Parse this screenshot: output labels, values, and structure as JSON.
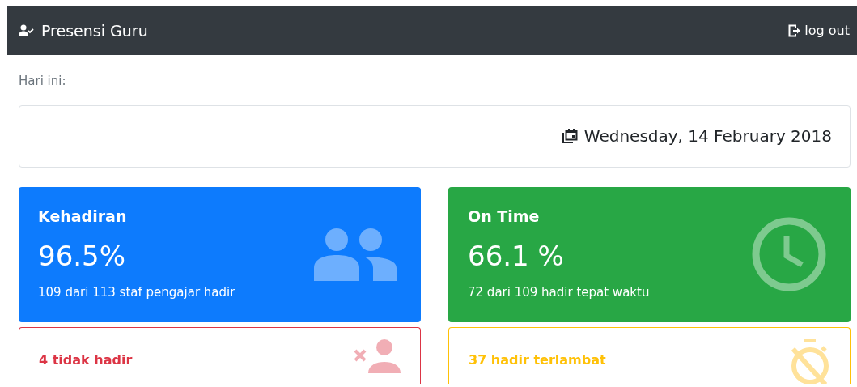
{
  "navbar": {
    "brand": "Presensi Guru",
    "logout": "log out"
  },
  "today_label": "Hari ini:",
  "date": "Wednesday, 14 February 2018",
  "stats": [
    {
      "kind": "primary",
      "title": "Kehadiran",
      "value": "96.5%",
      "detail": "109 dari 113 staf pengajar hadir"
    },
    {
      "kind": "success",
      "title": "On Time",
      "value": "66.1 %",
      "detail": "72 dari 109 hadir tepat waktu"
    }
  ],
  "alerts": [
    {
      "kind": "danger",
      "title": "4 tidak hadir"
    },
    {
      "kind": "warning",
      "title": "37 hadir terlambat"
    }
  ]
}
